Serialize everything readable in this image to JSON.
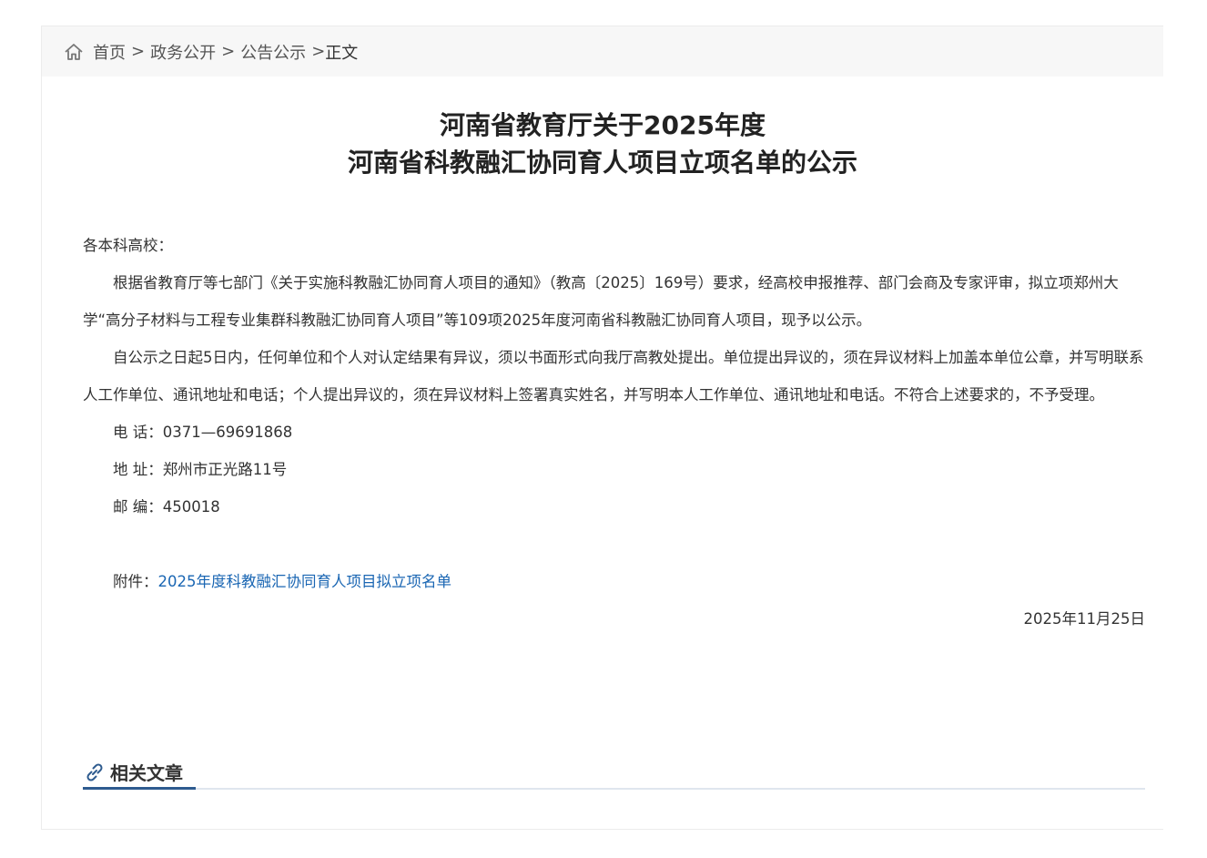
{
  "breadcrumb": {
    "items": [
      "首页",
      "政务公开",
      "公告公示"
    ],
    "separator": ">",
    "current": "正文"
  },
  "article": {
    "title_line1": "河南省教育厅关于2025年度",
    "title_line2": "河南省科教融汇协同育人项目立项名单的公示",
    "salutation": "各本科高校：",
    "para1": "根据省教育厅等七部门《关于实施科教融汇协同育人项目的通知》（教高〔2025〕169号）要求，经高校申报推荐、部门会商及专家评审，拟立项郑州大学“高分子材料与工程专业集群科教融汇协同育人项目”等109项2025年度河南省科教融汇协同育人项目，现予以公示。",
    "para2": "自公示之日起5日内，任何单位和个人对认定结果有异议，须以书面形式向我厅高教处提出。单位提出异议的，须在异议材料上加盖本单位公章，并写明联系人工作单位、通讯地址和电话；个人提出异议的，须在异议材料上签署真实姓名，并写明本人工作单位、通讯地址和电话。不符合上述要求的，不予受理。",
    "phone": "电 话：0371—69691868",
    "address": "地 址：郑州市正光路11号",
    "postcode": "邮 编：450018",
    "attachment_label": "附件：",
    "attachment_link": "2025年度科教融汇协同育人项目拟立项名单",
    "date": "2025年11月25日"
  },
  "related": {
    "title": "相关文章"
  },
  "colors": {
    "link": "#1a66b3",
    "accent": "#2e5b8f",
    "breadcrumb_bg": "#f7f7f7"
  }
}
